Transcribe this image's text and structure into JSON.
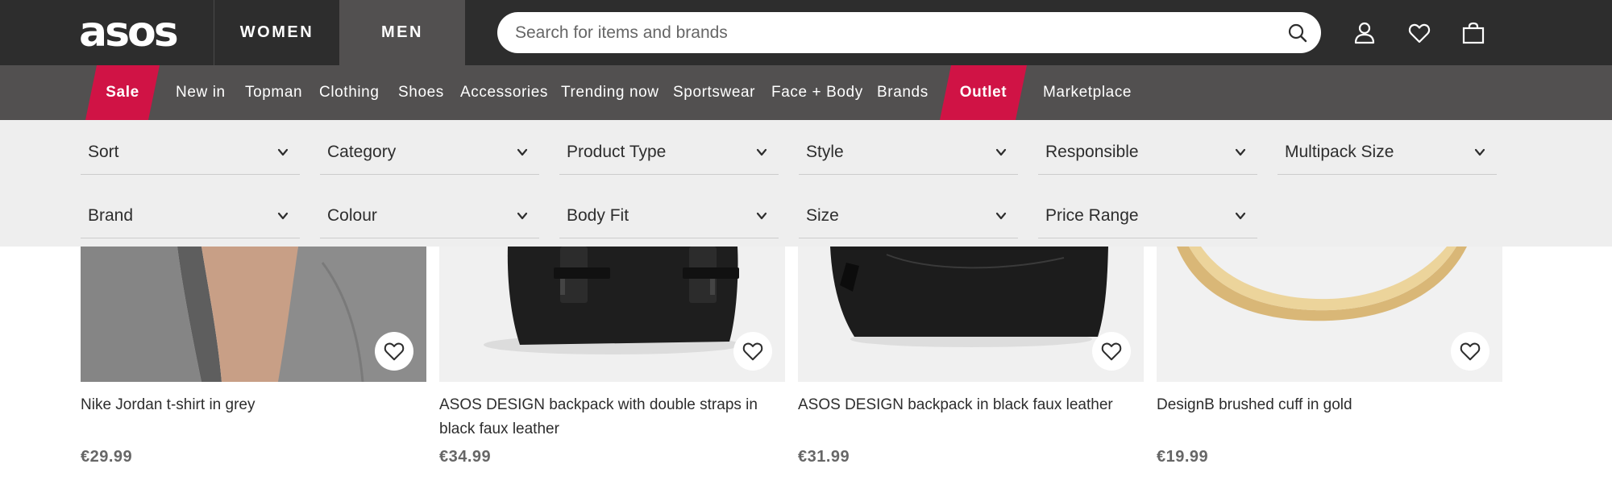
{
  "header": {
    "logo": "asos",
    "tabs": [
      {
        "label": "WOMEN",
        "active": false
      },
      {
        "label": "MEN",
        "active": true
      }
    ],
    "search": {
      "placeholder": "Search for items and brands",
      "value": ""
    },
    "icons": [
      "search-icon",
      "account-icon",
      "heart-icon",
      "bag-icon"
    ]
  },
  "nav": {
    "items": [
      {
        "label": "Sale",
        "highlight": true
      },
      {
        "label": "New in"
      },
      {
        "label": "Topman"
      },
      {
        "label": "Clothing"
      },
      {
        "label": "Shoes"
      },
      {
        "label": "Accessories"
      },
      {
        "label": "Trending now"
      },
      {
        "label": "Sportswear"
      },
      {
        "label": "Face + Body"
      },
      {
        "label": "Brands"
      },
      {
        "label": "Outlet",
        "highlight": true
      },
      {
        "label": "Marketplace"
      }
    ],
    "highlight_color": "#d01345"
  },
  "filters": [
    {
      "label": "Sort"
    },
    {
      "label": "Category"
    },
    {
      "label": "Product Type"
    },
    {
      "label": "Style"
    },
    {
      "label": "Responsible"
    },
    {
      "label": "Multipack Size"
    },
    {
      "label": "Brand"
    },
    {
      "label": "Colour"
    },
    {
      "label": "Body Fit"
    },
    {
      "label": "Size"
    },
    {
      "label": "Price Range"
    }
  ],
  "products": [
    {
      "name": "Nike Jordan t-shirt in grey",
      "price": "€29.99"
    },
    {
      "name": "ASOS DESIGN backpack with double straps in black faux leather",
      "price": "€34.99"
    },
    {
      "name": "ASOS DESIGN backpack in black faux leather",
      "price": "€31.99"
    },
    {
      "name": "DesignB brushed cuff in gold",
      "price": "€19.99"
    }
  ],
  "colors": {
    "header_bg": "#2d2d2d",
    "nav_bg": "#525050",
    "filter_bg": "#eeeeee",
    "accent": "#d01345"
  }
}
